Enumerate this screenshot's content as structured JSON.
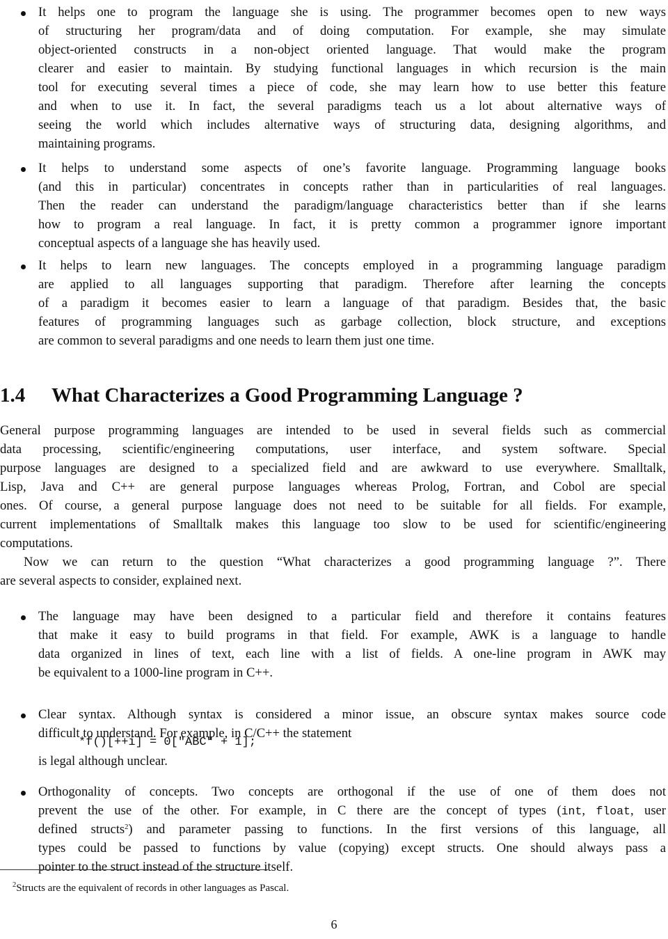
{
  "document": {
    "bullets_top": [
      {
        "lines": [
          "It helps one to program the language she is using. The programmer becomes open to new ways",
          "of structuring her program/data and of doing computation. For example, she may simulate",
          "object-oriented constructs in a non-object oriented language. That would make the program",
          "clearer and easier to maintain. By studying functional languages in which recursion is the main",
          "tool for executing several times a piece of code, she may learn how to use better this feature",
          "and when to use it. In fact, the several paradigms teach us a lot about alternative ways of",
          "seeing the world which includes alternative ways of structuring data, designing algorithms, and",
          "maintaining programs."
        ]
      },
      {
        "lines": [
          "It helps to understand some aspects of one’s favorite language. Programming language books",
          "(and this in particular) concentrates in concepts rather than in particularities of real languages.",
          "Then the reader can understand the paradigm/language characteristics better than if she learns",
          "how to program a real language. In fact, it is pretty common a programmer ignore important",
          "conceptual aspects of a language she has heavily used."
        ]
      },
      {
        "lines": [
          "It helps to learn new languages. The concepts employed in a programming language paradigm",
          "are applied to all languages supporting that paradigm. Therefore after learning the concepts",
          "of a paradigm it becomes easier to learn a language of that paradigm. Besides that, the basic",
          "features of programming languages such as garbage collection, block structure, and exceptions",
          "are common to several paradigms and one needs to learn them just one time."
        ]
      }
    ],
    "section": {
      "number": "1.4",
      "title": "What Characterizes a Good Programming Language ?"
    },
    "paragraph1": [
      "General purpose programming languages are intended to be used in several fields such as commercial",
      "data processing, scientific/engineering computations, user interface, and system software. Special",
      "purpose languages are designed to a specialized field and are awkward to use everywhere. Smalltalk,",
      "Lisp, Java and C++ are general purpose languages whereas Prolog, Fortran, and Cobol are special",
      "ones. Of course, a general purpose language does not need to be suitable for all fields. For example,",
      "current implementations of Smalltalk makes this language too slow to be used for scientific/engineering",
      "computations."
    ],
    "paragraph2": [
      "Now we can return to the question “What characterizes a good programming language ?”. There",
      "are several aspects to consider, explained next."
    ],
    "bullets_bottom": {
      "field": [
        "The language may have been designed to a particular field and therefore it contains features",
        "that make it easy to build programs in that field. For example, AWK is a language to handle",
        "data organized in lines of text, each line with a list of fields. A one-line program in AWK may",
        "be equivalent to a 1000-line program in C++."
      ],
      "syntax": {
        "line1": "Clear syntax. Although syntax is considered a minor issue, an obscure syntax makes source code",
        "line2": "difficult to understand. For example, in C/C++ the statement",
        "code": "*f()[++i] = 0[\"ABC\" + 1];",
        "line3": "is legal although unclear."
      },
      "orthogonality": {
        "line1": "Orthogonality of concepts. Two concepts are orthogonal if the use of one of them does not",
        "line2_pre": "prevent the use of the other. For example, in C there are the concept of types (",
        "code_int": "int",
        "sep": ", ",
        "code_float": "float",
        "line2_post": ", user",
        "line3_pre": "defined structs",
        "footnote_mark": "2",
        "line3_post": ") and parameter passing to functions. In the first versions of this language, all",
        "line4": "types could be passed to functions by value (copying) except structs. One should always pass a",
        "line5": "pointer to the struct instead of the structure itself."
      }
    },
    "footnote": {
      "mark": "2",
      "text": "Structs are the equivalent of records in other languages as Pascal."
    },
    "page_number": "6"
  }
}
